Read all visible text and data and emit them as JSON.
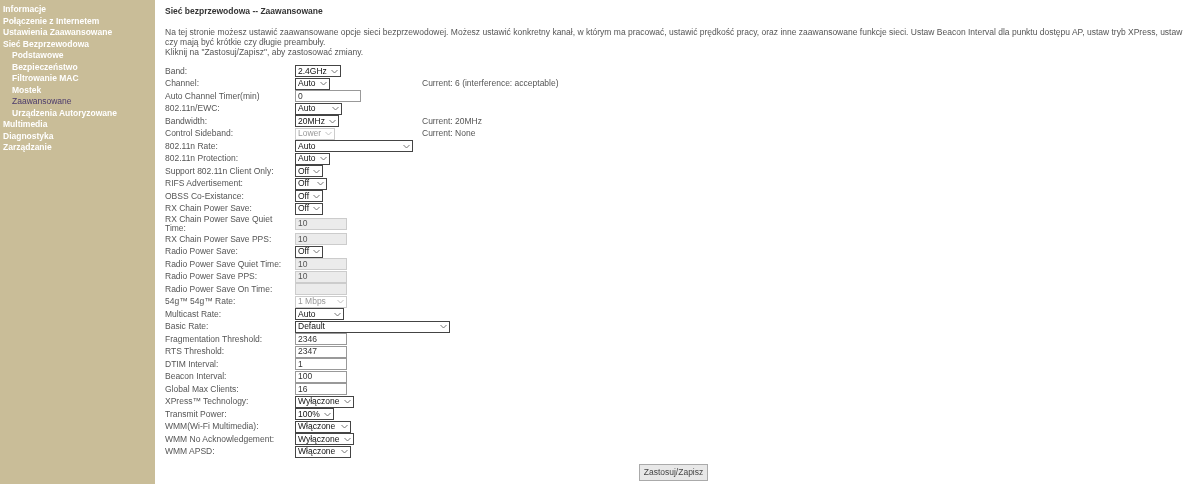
{
  "sidebar": {
    "items": [
      {
        "label": "Informacje",
        "selected": false
      },
      {
        "label": "Połączenie z Internetem",
        "selected": false
      },
      {
        "label": "Ustawienia Zaawansowane",
        "selected": false
      },
      {
        "label": "Sieć Bezprzewodowa",
        "selected": false,
        "children": [
          {
            "label": "Podstawowe",
            "selected": false
          },
          {
            "label": "Bezpieczeństwo",
            "selected": false
          },
          {
            "label": "Filtrowanie MAC",
            "selected": false
          },
          {
            "label": "Mostek",
            "selected": false
          },
          {
            "label": "Zaawansowane",
            "selected": true
          },
          {
            "label": "Urządzenia Autoryzowane",
            "selected": false
          }
        ]
      },
      {
        "label": "Multimedia",
        "selected": false
      },
      {
        "label": "Diagnostyka",
        "selected": false
      },
      {
        "label": "Zarządzanie",
        "selected": false
      }
    ]
  },
  "page_title": "Sieć bezprzewodowa -- Zaawansowane",
  "description": "Na tej stronie możesz ustawić zaawansowane opcje sieci bezprzewodowej. Możesz ustawić konkretny kanał, w którym ma pracować, ustawić prędkość pracy, oraz inne zaawansowane funkcje sieci. Ustaw Beacon Interval dla punktu dostępu AP, ustaw tryb XPress, ustaw czy mają być krótkie czy długie preambuły.",
  "instruction": "Kliknij na \"Zastosuj/Zapisz\", aby zastosować zmiany.",
  "settings": [
    {
      "label": "Band:",
      "kind": "select",
      "value": "2.4GHz",
      "disabled": false
    },
    {
      "label": "Channel:",
      "kind": "select",
      "value": "Auto",
      "disabled": false,
      "note": "Current: 6 (interference: acceptable)"
    },
    {
      "label": "Auto Channel Timer(min)",
      "kind": "input",
      "value": "0",
      "disabled": false
    },
    {
      "label": "802.11n/EWC:",
      "kind": "select",
      "value": "Auto",
      "disabled": false
    },
    {
      "label": "Bandwidth:",
      "kind": "select",
      "value": "20MHz",
      "disabled": false,
      "note": "Current: 20MHz"
    },
    {
      "label": "Control Sideband:",
      "kind": "select",
      "value": "Lower",
      "disabled": true,
      "note": "Current: None"
    },
    {
      "label": "802.11n Rate:",
      "kind": "select",
      "value": "Auto",
      "disabled": false
    },
    {
      "label": "802.11n Protection:",
      "kind": "select",
      "value": "Auto",
      "disabled": false
    },
    {
      "label": "Support 802.11n Client Only:",
      "kind": "select",
      "value": "Off",
      "disabled": false
    },
    {
      "label": "RIFS Advertisement:",
      "kind": "select",
      "value": "Off",
      "disabled": false
    },
    {
      "label": "OBSS Co-Existance:",
      "kind": "select",
      "value": "Off",
      "disabled": false
    },
    {
      "label": "RX Chain Power Save:",
      "kind": "select",
      "value": "Off",
      "disabled": false
    },
    {
      "label": "RX Chain Power Save Quiet Time:",
      "kind": "input",
      "value": "10",
      "disabled": true
    },
    {
      "label": "RX Chain Power Save PPS:",
      "kind": "input",
      "value": "10",
      "disabled": true
    },
    {
      "label": "Radio Power Save:",
      "kind": "select",
      "value": "Off",
      "disabled": false
    },
    {
      "label": "Radio Power Save Quiet Time:",
      "kind": "input",
      "value": "10",
      "disabled": true
    },
    {
      "label": "Radio Power Save PPS:",
      "kind": "input",
      "value": "10",
      "disabled": true
    },
    {
      "label": "Radio Power Save On Time:",
      "kind": "input",
      "disabled": true
    },
    {
      "label": "54g™ 54g™ Rate:",
      "kind": "select",
      "value": "1 Mbps",
      "disabled": true
    },
    {
      "label": "Multicast Rate:",
      "kind": "select",
      "value": "Auto",
      "disabled": false
    },
    {
      "label": "Basic Rate:",
      "kind": "select",
      "value": "Default",
      "disabled": false
    },
    {
      "label": "Fragmentation Threshold:",
      "kind": "input",
      "value": "2346",
      "disabled": false
    },
    {
      "label": "RTS Threshold:",
      "kind": "input",
      "value": "2347",
      "disabled": false
    },
    {
      "label": "DTIM Interval:",
      "kind": "input",
      "value": "1",
      "disabled": false
    },
    {
      "label": "Beacon Interval:",
      "kind": "input",
      "value": "100",
      "disabled": false
    },
    {
      "label": "Global Max Clients:",
      "kind": "input",
      "value": "16",
      "disabled": false
    },
    {
      "label": "XPress™ Technology:",
      "kind": "select",
      "value": "Wyłączone",
      "disabled": false
    },
    {
      "label": "Transmit Power:",
      "kind": "select",
      "value": "100%",
      "disabled": false
    },
    {
      "label": "WMM(Wi-Fi Multimedia):",
      "kind": "select",
      "value": "Włączone",
      "disabled": false
    },
    {
      "label": "WMM No Acknowledgement:",
      "kind": "select",
      "value": "Wyłączone",
      "disabled": false
    },
    {
      "label": "WMM APSD:",
      "kind": "select",
      "value": "Włączone",
      "disabled": false
    }
  ],
  "apply_button": "Zastosuj/Zapisz"
}
